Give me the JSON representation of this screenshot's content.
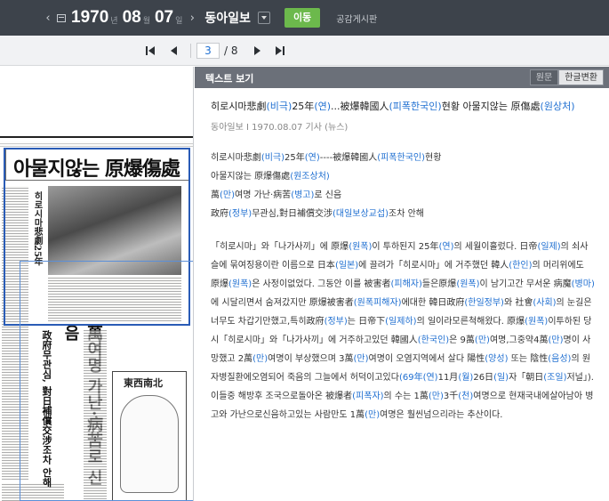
{
  "topbar": {
    "year": "1970",
    "year_unit": "년",
    "month": "08",
    "month_unit": "월",
    "day": "07",
    "day_unit": "일",
    "newspaper": "동아일보",
    "move_label": "이동",
    "board_label": "공감게시판"
  },
  "pager": {
    "current": "3",
    "total": "/ 8"
  },
  "panel": {
    "title": "텍스트 보기",
    "original": "원문",
    "hangul": "한글변환"
  },
  "newspaper_image": {
    "headline": "아물지않는 原爆傷處",
    "side_headline": "萬여명 가난·病苦로 신음",
    "vertical_text": "政府무관심, 對日補償交涉조차 안해",
    "cartoon": "東西南北"
  },
  "article": {
    "title": "히로시마悲劇(비극)25年(연)...被爆韓國人(피폭한국인)현황 아물지않는 原傷處(원상처)",
    "meta": "동아일보 I 1970.08.07 기사 (뉴스)",
    "summary": [
      "히로시마悲劇(비극)25年(연)----被爆韓國人(피폭한국인)현황",
      "아물지않는 原爆傷處(원조상처)",
      "萬(만)여명 가난·病苦(병고)로 신음",
      "政府(정부)무관심,對日補償交涉(대일보상교섭)조차 안해"
    ],
    "body": "「히로시마」와「나가사끼」에 原爆(원폭)이 투하된지 25年(연)의 세월이흘렀다. 日帝(일제)의 쇠사슬에 묶여징용이란 이름으로 日本(일본)에 끌려가「히로시마」에 거주했던 韓人(한인)의 머리위에도 原爆(원폭)은 사정이없었다. 그동안 이를 被害者(피해자)들은原爆(원폭)이 남기고간 무서운 病魔(병마)에 시달리면서 숨져갔지만 原爆被害者(원폭피해자)에대한 韓日政府(한일정부)와 社會(사회)의 눈길은너무도 차갑기만했고,특히政府(정부)는 日帝下(일제하)의 일이라모른척해왔다. 原爆(원폭)이투하된 당시「히로시마」와「나가사끼」에 거주하고있던 韓國人(한국인)은 9萬(만)여명,그중약4萬(만)명이 사망했고 2萬(만)여명이 부상했으며 3萬(만)여명이 오염지역에서 살다 陽性(양성) 또는 陰性(음성)의 원자병질환에오염되어 죽음의 그늘에서 허덕이고있다(69年(연)11月(월)26日(일)자「朝日(조일)저널」). 이들중 해방후 조국으로돌아온 被爆者(피폭자)의 수는 1萬(만)3千(천)여명으로 현재국내에살아남아 병고와 가난으로신음하고있는 사람만도 1萬(만)여명은 훨씬넘으리라는 추산이다."
  }
}
